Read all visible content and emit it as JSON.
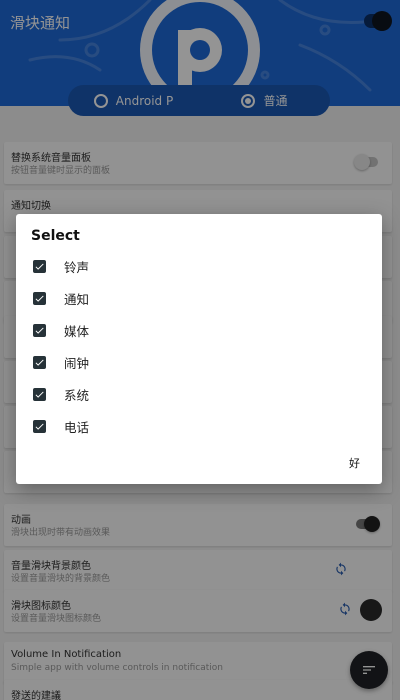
{
  "header": {
    "title": "滑块通知",
    "master_switch_on": true,
    "mode_options": [
      {
        "label": "Android P",
        "selected": false
      },
      {
        "label": "普通",
        "selected": true
      }
    ]
  },
  "settings": [
    {
      "title": "替换系统音量面板",
      "subtitle": "按钮音量键时显示的面板",
      "control": "toggle",
      "on": false
    },
    {
      "title": "通知切换",
      "subtitle": "",
      "control": "none"
    },
    {
      "title": "",
      "subtitle": "",
      "control": "none"
    },
    {
      "title": "",
      "subtitle": "",
      "control": "none"
    },
    {
      "title": "",
      "subtitle": "",
      "control": "none"
    },
    {
      "title": "",
      "subtitle": "",
      "control": "none"
    },
    {
      "title": "",
      "subtitle": "",
      "control": "none"
    },
    {
      "title": "",
      "subtitle": "",
      "control": "none"
    },
    {
      "title": "动画",
      "subtitle": "滑块出现时带有动画效果",
      "control": "toggle",
      "on": true
    },
    {
      "title": "音量滑块背景颜色",
      "subtitle": "设置音量滑块的背景颜色",
      "control": "refresh"
    },
    {
      "title": "滑块图标颜色",
      "subtitle": "设置音量滑块图标颜色",
      "control": "refresh-color"
    },
    {
      "title": "Volume In Notification",
      "subtitle": "Simple app with volume controls in notification",
      "control": "none"
    },
    {
      "title": "發送的建議",
      "subtitle": "",
      "control": "none"
    }
  ],
  "dialog": {
    "title": "Select",
    "options": [
      {
        "label": "铃声",
        "checked": true
      },
      {
        "label": "通知",
        "checked": true
      },
      {
        "label": "媒体",
        "checked": true
      },
      {
        "label": "闹钟",
        "checked": true
      },
      {
        "label": "系统",
        "checked": true
      },
      {
        "label": "电话",
        "checked": true
      }
    ],
    "ok_label": "好"
  },
  "colors": {
    "header": "#1e69d8",
    "mode_bar": "#1b59b4",
    "dialog_bg": "#ffffff",
    "checkbox": "#263238",
    "fab": "#1f2226"
  },
  "icons": {
    "fab": "sort-icon",
    "refresh": "refresh-icon",
    "check": "check-icon"
  }
}
